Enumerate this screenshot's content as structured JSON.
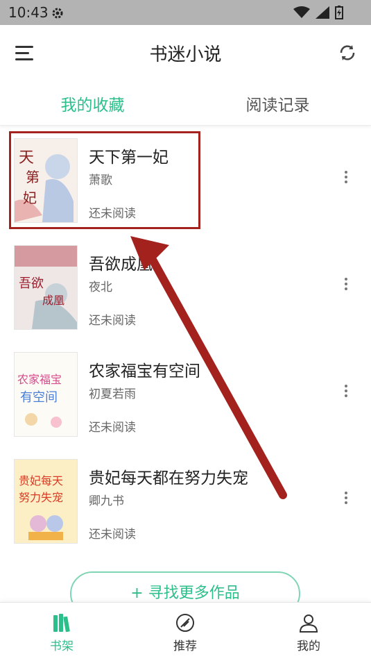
{
  "status_bar": {
    "time": "10:43",
    "icons": [
      "gear-icon",
      "wifi-icon",
      "signal-icon",
      "battery-icon"
    ]
  },
  "header": {
    "title": "书迷小说",
    "menu_icon": "menu-icon",
    "refresh_icon": "refresh-icon"
  },
  "tabs": [
    {
      "label": "我的收藏",
      "active": true
    },
    {
      "label": "阅读记录",
      "active": false
    }
  ],
  "books": [
    {
      "title": "天下第一妃",
      "author": "萧歌",
      "progress": "还未阅读",
      "cover_text": "天下第一妃"
    },
    {
      "title": "吾欲成凰",
      "author": "夜北",
      "progress": "还未阅读",
      "cover_text": "吾欲成凰"
    },
    {
      "title": "农家福宝有空间",
      "author": "初夏若雨",
      "progress": "还未阅读",
      "cover_text": "农家福宝有空间"
    },
    {
      "title": "贵妃每天都在努力失宠",
      "author": "卿九书",
      "progress": "还未阅读",
      "cover_text": "贵妃每天都努力失宠"
    }
  ],
  "find_more_label": "+ 寻找更多作品",
  "bottom_nav": [
    {
      "label": "书架",
      "icon": "bookshelf-icon",
      "active": true
    },
    {
      "label": "推荐",
      "icon": "recommend-icon",
      "active": false
    },
    {
      "label": "我的",
      "icon": "profile-icon",
      "active": false
    }
  ],
  "colors": {
    "accent": "#2cbf8a",
    "annotation": "#a3221e",
    "status_bar": "#b3b3b3"
  }
}
